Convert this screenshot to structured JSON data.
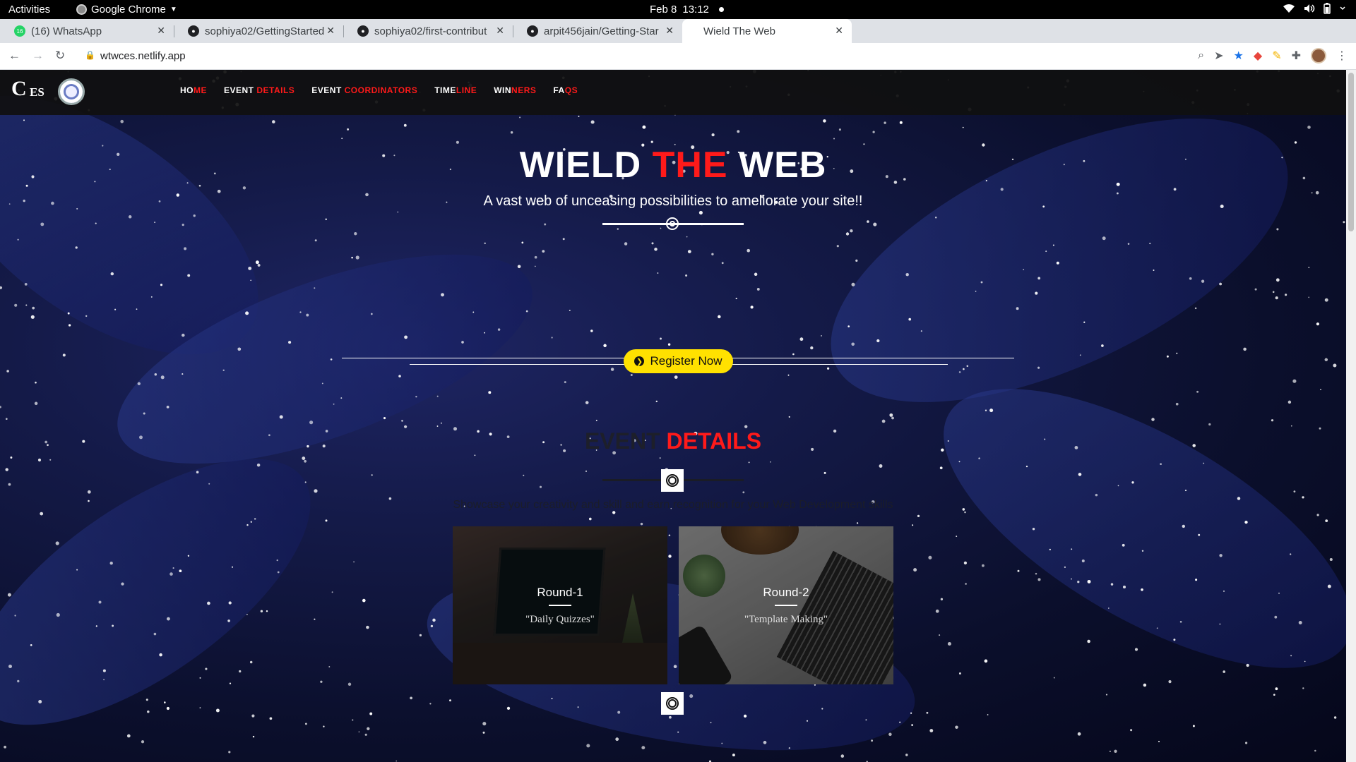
{
  "system": {
    "activities": "Activities",
    "app_name": "Google Chrome",
    "clock_date": "Feb 8",
    "clock_time": "13:12"
  },
  "browser": {
    "tabs": [
      {
        "title": "(16) WhatsApp",
        "favicon": "whatsapp-icon",
        "active": false
      },
      {
        "title": "sophiya02/GettingStarted",
        "favicon": "github-icon",
        "active": false
      },
      {
        "title": "sophiya02/first-contribut",
        "favicon": "github-icon",
        "active": false
      },
      {
        "title": "arpit456jain/Getting-Star",
        "favicon": "github-icon",
        "active": false
      },
      {
        "title": "Wield The Web",
        "favicon": "",
        "active": true
      }
    ],
    "url": "wtwces.netlify.app"
  },
  "site": {
    "nav": [
      {
        "white": "HO",
        "red": "ME"
      },
      {
        "white": "EVENT ",
        "red": "DETAILS"
      },
      {
        "white": "EVENT ",
        "red": "COORDINATORS"
      },
      {
        "white": "TIME",
        "red": "LINE"
      },
      {
        "white": "WIN",
        "red": "NERS"
      },
      {
        "white": "FA",
        "red": "QS"
      }
    ],
    "hero": {
      "title_part1": "WIELD ",
      "title_part2": "THE",
      "title_part3": " WEB",
      "subtitle": "A vast web of unceasing possibilities to ameliorate your site!!"
    },
    "register_label": "Register Now",
    "section": {
      "title_dim": "EVENT ",
      "title_red": "DETAILS",
      "description": "Showcase your creativity and skill and earn recognition for your Web Development skills"
    },
    "cards": [
      {
        "round": "Round-1",
        "theme": "\"Daily Quizzes\""
      },
      {
        "round": "Round-2",
        "theme": "\"Template Making\""
      }
    ]
  },
  "colors": {
    "accent_red": "#ff1a1a",
    "button_yellow": "#ffe100",
    "nav_bg": "#101010"
  }
}
